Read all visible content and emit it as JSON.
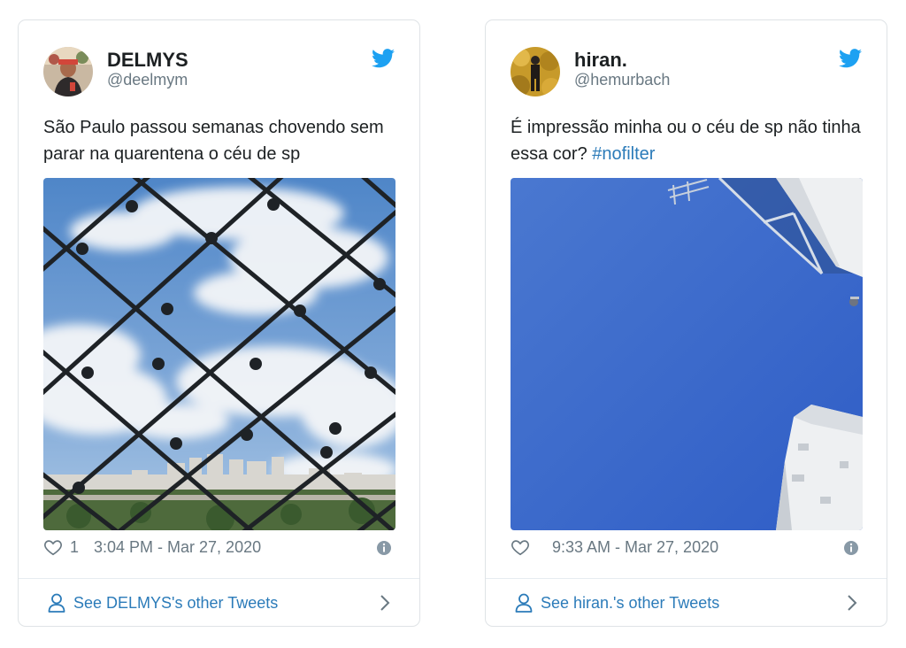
{
  "tweets": [
    {
      "display_name": "DELMYS",
      "handle": "@deelmym",
      "text": "São Paulo passou semanas chovendo sem parar na quarentena o céu de sp",
      "hashtag": "",
      "likes": "1",
      "timestamp": "3:04 PM - Mar 27, 2020",
      "more_label": "See DELMYS's other Tweets"
    },
    {
      "display_name": "hiran.",
      "handle": "@hemurbach",
      "text": "É impressão minha ou o céu de sp não tinha essa cor? ",
      "hashtag": "#nofilter",
      "likes": "",
      "timestamp": "9:33 AM - Mar 27, 2020",
      "more_label": "See hiran.'s other Tweets"
    }
  ],
  "icons": {
    "brand": "twitter-bird-icon",
    "like": "heart-icon",
    "info": "info-icon",
    "profile": "person-icon",
    "more": "chevron-right-icon"
  },
  "colors": {
    "twitter_blue": "#1da1f2",
    "link_blue": "#2b7bb9",
    "muted_text": "#697882",
    "border": "#dfe3e6"
  }
}
